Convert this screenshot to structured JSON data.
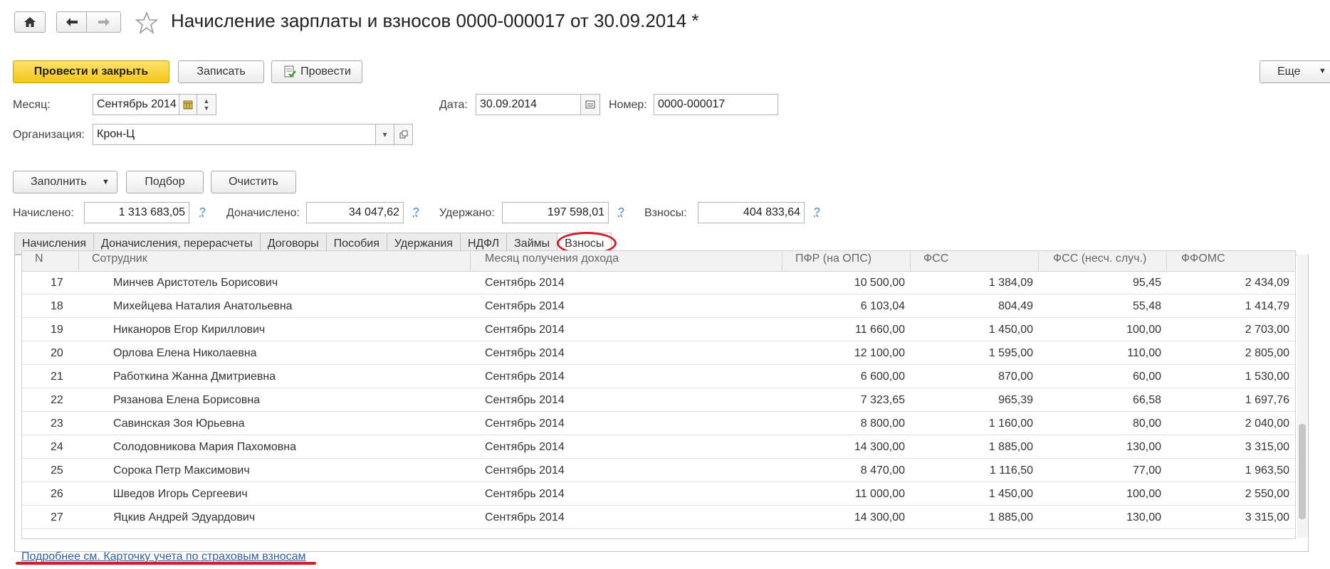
{
  "document": {
    "title": "Начисление зарплаты и взносов 0000-000017 от 30.09.2014 *"
  },
  "toolbar": {
    "post_and_close": "Провести и закрыть",
    "save": "Записать",
    "post": "Провести",
    "more": "Еще"
  },
  "form": {
    "month_label": "Месяц:",
    "month_value": "Сентябрь 2014",
    "date_label": "Дата:",
    "date_value": "30.09.2014",
    "number_label": "Номер:",
    "number_value": "0000-000017",
    "org_label": "Организация:",
    "org_value": "Крон-Ц"
  },
  "actions": {
    "fill": "Заполнить",
    "select": "Подбор",
    "clear": "Очистить"
  },
  "totals": {
    "accrued_label": "Начислено:",
    "accrued_value": "1 313 683,05",
    "additional_label": "Доначислено:",
    "additional_value": "34 047,62",
    "withheld_label": "Удержано:",
    "withheld_value": "197 598,01",
    "contributions_label": "Взносы:",
    "contributions_value": "404 833,64",
    "help": "?"
  },
  "tabs": [
    {
      "label": "Начисления"
    },
    {
      "label": "Доначисления, перерасчеты"
    },
    {
      "label": "Договоры"
    },
    {
      "label": "Пособия"
    },
    {
      "label": "Удержания"
    },
    {
      "label": "НДФЛ"
    },
    {
      "label": "Займы"
    },
    {
      "label": "Взносы",
      "active": true
    }
  ],
  "grid": {
    "columns": [
      "N",
      "Сотрудник",
      "Месяц получения дохода",
      "ПФР (на ОПС)",
      "ФСС",
      "ФСС (несч. случ.)",
      "ФФОМС"
    ],
    "rows": [
      {
        "n": "17",
        "employee": "Минчев Аристотель Борисович",
        "month": "Сентябрь 2014",
        "pfr": "10 500,00",
        "fss": "1 384,09",
        "fss_ns": "95,45",
        "ffoms": "2 434,09"
      },
      {
        "n": "18",
        "employee": "Михейцева Наталия Анатольевна",
        "month": "Сентябрь 2014",
        "pfr": "6 103,04",
        "fss": "804,49",
        "fss_ns": "55,48",
        "ffoms": "1 414,79"
      },
      {
        "n": "19",
        "employee": "Никаноров Егор Кириллович",
        "month": "Сентябрь 2014",
        "pfr": "11 660,00",
        "fss": "1 450,00",
        "fss_ns": "100,00",
        "ffoms": "2 703,00"
      },
      {
        "n": "20",
        "employee": "Орлова Елена Николаевна",
        "month": "Сентябрь 2014",
        "pfr": "12 100,00",
        "fss": "1 595,00",
        "fss_ns": "110,00",
        "ffoms": "2 805,00"
      },
      {
        "n": "21",
        "employee": "Работкина Жанна Дмитриевна",
        "month": "Сентябрь 2014",
        "pfr": "6 600,00",
        "fss": "870,00",
        "fss_ns": "60,00",
        "ffoms": "1 530,00"
      },
      {
        "n": "22",
        "employee": "Рязанова Елена Борисовна",
        "month": "Сентябрь 2014",
        "pfr": "7 323,65",
        "fss": "965,39",
        "fss_ns": "66,58",
        "ffoms": "1 697,76"
      },
      {
        "n": "23",
        "employee": "Савинская Зоя Юрьевна",
        "month": "Сентябрь 2014",
        "pfr": "8 800,00",
        "fss": "1 160,00",
        "fss_ns": "80,00",
        "ffoms": "2 040,00"
      },
      {
        "n": "24",
        "employee": "Солодовникова Мария Пахомовна",
        "month": "Сентябрь 2014",
        "pfr": "14 300,00",
        "fss": "1 885,00",
        "fss_ns": "130,00",
        "ffoms": "3 315,00"
      },
      {
        "n": "25",
        "employee": "Сорока Петр Максимович",
        "month": "Сентябрь 2014",
        "pfr": "8 470,00",
        "fss": "1 116,50",
        "fss_ns": "77,00",
        "ffoms": "1 963,50"
      },
      {
        "n": "26",
        "employee": "Шведов Игорь Сергеевич",
        "month": "Сентябрь 2014",
        "pfr": "11 000,00",
        "fss": "1 450,00",
        "fss_ns": "100,00",
        "ffoms": "2 550,00"
      },
      {
        "n": "27",
        "employee": "Яцкив Андрей Эдуардович",
        "month": "Сентябрь 2014",
        "pfr": "14 300,00",
        "fss": "1 885,00",
        "fss_ns": "130,00",
        "ffoms": "3 315,00"
      }
    ]
  },
  "footer": {
    "link": "Подробнее см. Карточку учета по страховым взносам"
  },
  "colors": {
    "primary_button": "#f5c518",
    "annotation_red": "#d21d2a",
    "link": "#2f5f9e"
  }
}
